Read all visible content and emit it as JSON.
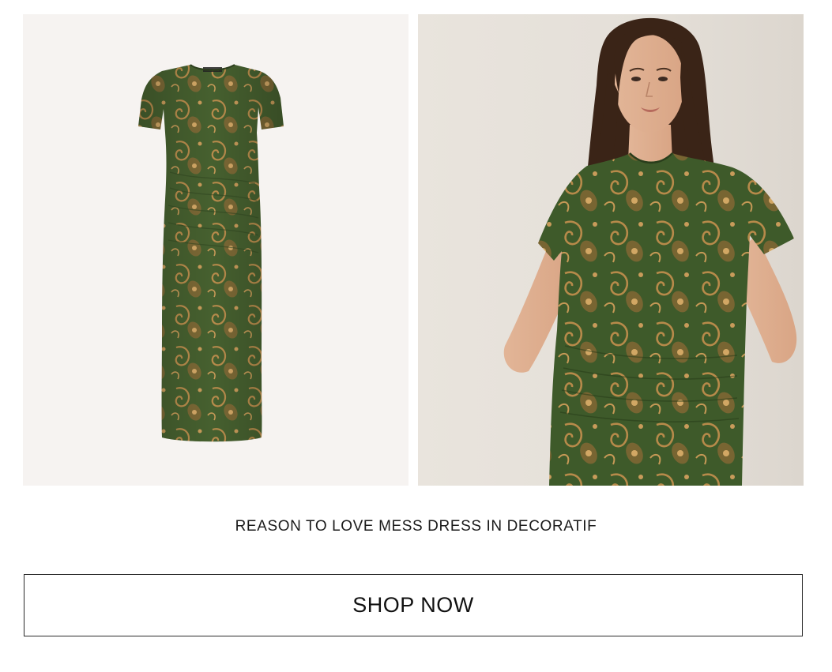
{
  "product": {
    "caption_prefix": "REASON TO LOVE ",
    "name": "MESS DRESS",
    "caption_suffix": " IN DECORATIF"
  },
  "cta": {
    "label": "SHOP NOW"
  },
  "images": {
    "flat_lay": "paisley-dress-flat-lay-image",
    "model": "model-wearing-paisley-dress-image"
  },
  "colors": {
    "dress_base": "#3f5a2c",
    "dress_print": "#b5894a",
    "panel_left_bg": "#f6f3f1",
    "panel_right_bg": "#e6e1da",
    "text": "#1a1a1a"
  }
}
